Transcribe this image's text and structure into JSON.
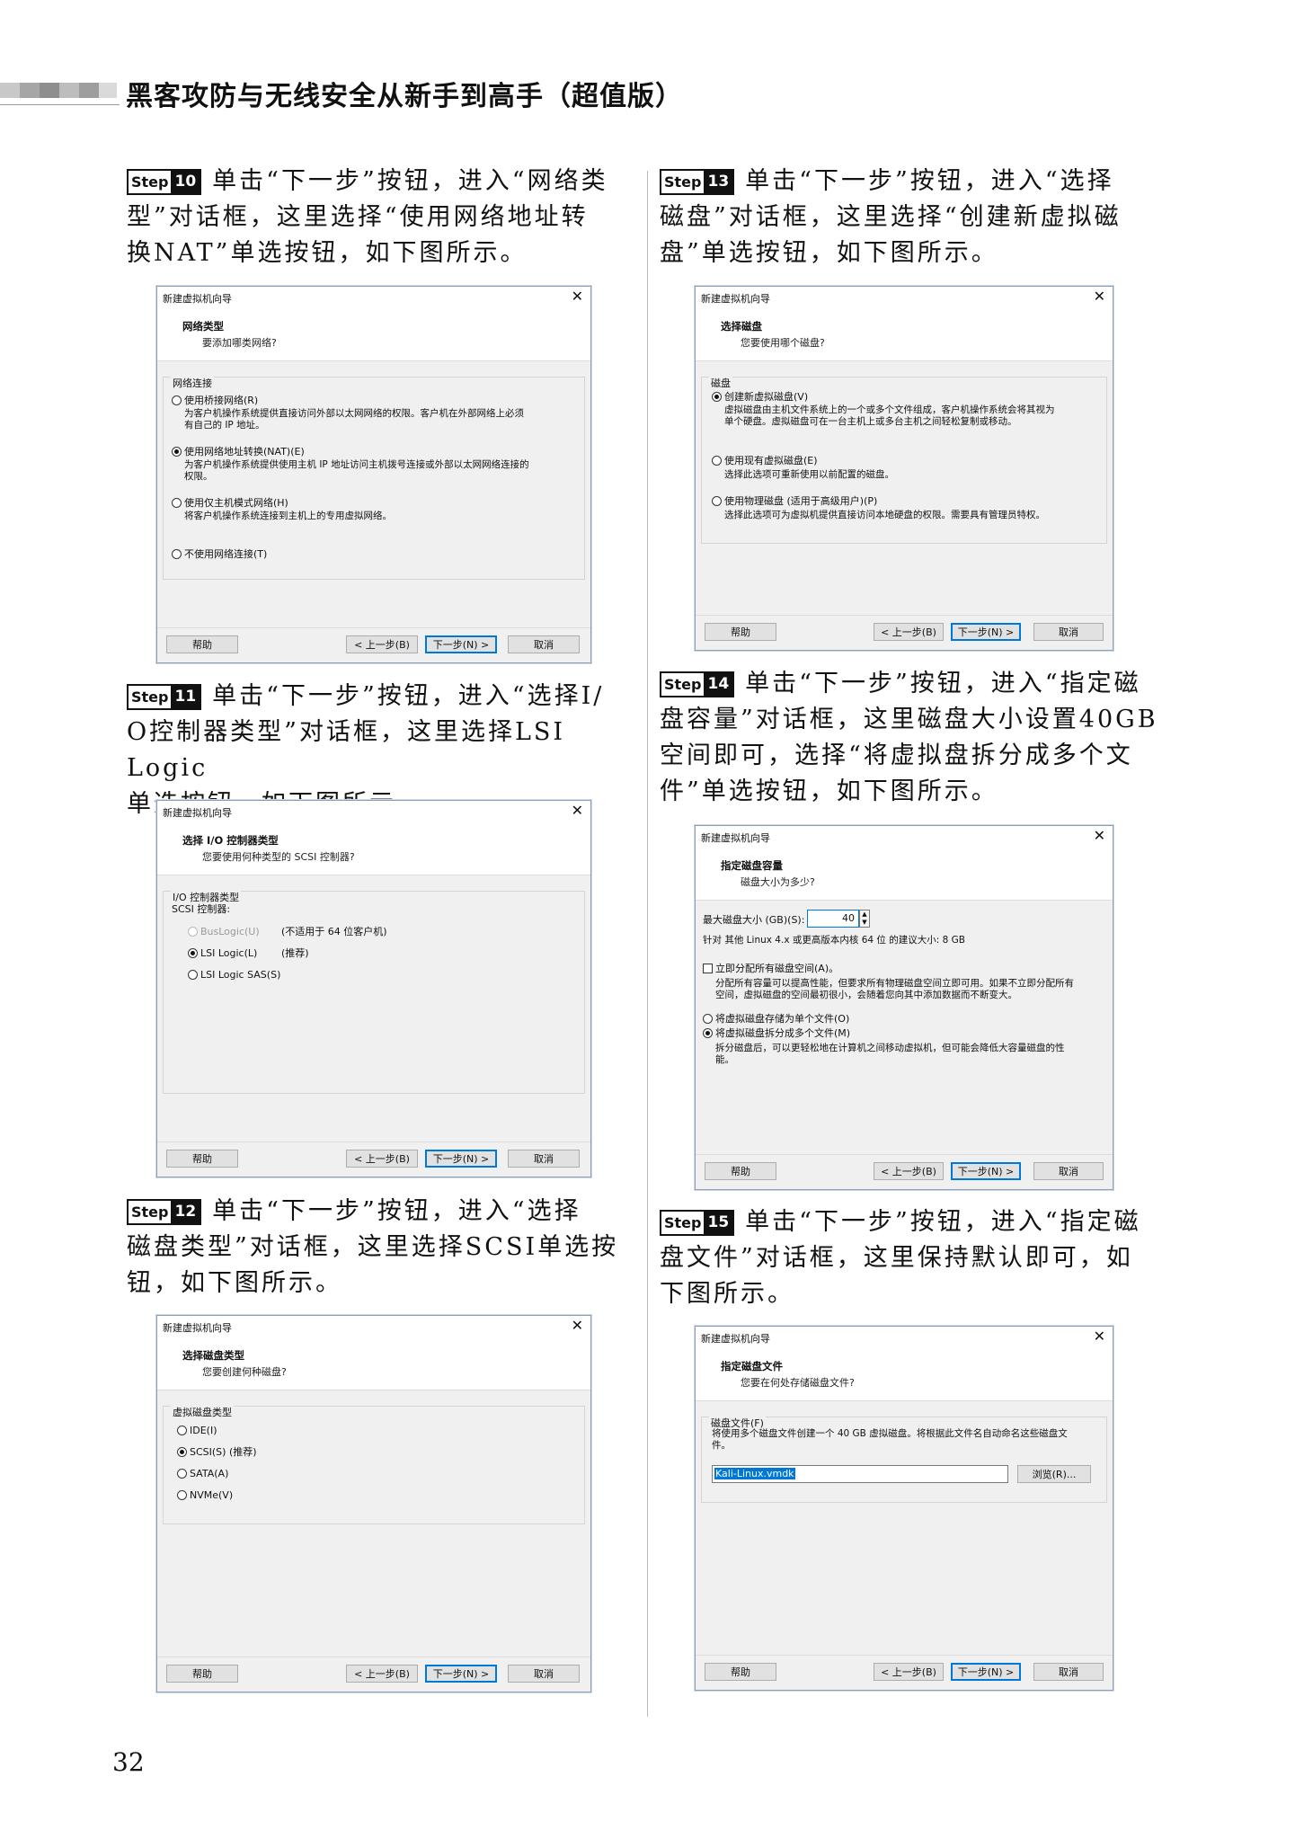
{
  "header": {
    "title": "黑客攻防与无线安全从新手到高手（超值版）",
    "bar_colors": [
      "#d0d0d0",
      "#b0b0b0",
      "#9a9a9a",
      "#c8c8c8",
      "#a8a8a8",
      "#e0e0e0"
    ]
  },
  "page_number": "32",
  "steps": [
    {
      "badge_word": "Step",
      "num": "10",
      "lines": [
        "单击“下一步”按钮，进入“网络类",
        "型”对话框，这里选择“使用网络地址转",
        "换NAT”单选按钮，如下图所示。"
      ]
    },
    {
      "badge_word": "Step",
      "num": "11",
      "lines": [
        "单击“下一步”按钮，进入“选择I/",
        "O控制器类型”对话框，这里选择LSI Logic",
        "单选按钮，如下图所示。"
      ]
    },
    {
      "badge_word": "Step",
      "num": "12",
      "lines": [
        "单击“下一步”按钮，进入“选择",
        "磁盘类型”对话框，这里选择SCSI单选按",
        "钮，如下图所示。"
      ]
    },
    {
      "badge_word": "Step",
      "num": "13",
      "lines": [
        "单击“下一步”按钮，进入“选择",
        "磁盘”对话框，这里选择“创建新虚拟磁",
        "盘”单选按钮，如下图所示。"
      ]
    },
    {
      "badge_word": "Step",
      "num": "14",
      "lines": [
        "单击“下一步”按钮，进入“指定磁",
        "盘容量”对话框，这里磁盘大小设置40GB",
        "空间即可，选择“将虚拟盘拆分成多个文",
        "件”单选按钮，如下图所示。"
      ]
    },
    {
      "badge_word": "Step",
      "num": "15",
      "lines": [
        "单击“下一步”按钮，进入“指定磁",
        "盘文件”对话框，这里保持默认即可，如",
        "下图所示。"
      ]
    }
  ],
  "dialog_common": {
    "window_title": "新建虚拟机向导",
    "close_glyph": "✕",
    "help": "帮助",
    "back": "< 上一步(B)",
    "next": "下一步(N) >",
    "cancel": "取消"
  },
  "dlg10": {
    "heading": "网络类型",
    "subheading": "要添加哪类网络?",
    "group": "网络连接",
    "options": [
      {
        "label": "使用桥接网络(R)",
        "desc": [
          "为客户机操作系统提供直接访问外部以太网网络的权限。客户机在外部网络上必须",
          "有自己的 IP 地址。"
        ],
        "selected": false
      },
      {
        "label": "使用网络地址转换(NAT)(E)",
        "desc": [
          "为客户机操作系统提供使用主机 IP 地址访问主机拨号连接或外部以太网网络连接的",
          "权限。"
        ],
        "selected": true
      },
      {
        "label": "使用仅主机模式网络(H)",
        "desc": [
          "将客户机操作系统连接到主机上的专用虚拟网络。"
        ],
        "selected": false
      },
      {
        "label": "不使用网络连接(T)",
        "desc": [],
        "selected": false
      }
    ]
  },
  "dlg11": {
    "heading": "选择 I/O 控制器类型",
    "subheading": "您要使用何种类型的 SCSI 控制器?",
    "group": "I/O 控制器类型",
    "sub_label": "SCSI 控制器:",
    "options": [
      {
        "label": "BusLogic(U)",
        "note": "(不适用于 64 位客户机)",
        "selected": false,
        "disabled": true
      },
      {
        "label": "LSI Logic(L)",
        "note": "(推荐)",
        "selected": true,
        "disabled": false
      },
      {
        "label": "LSI Logic SAS(S)",
        "note": "",
        "selected": false,
        "disabled": false
      }
    ]
  },
  "dlg12": {
    "heading": "选择磁盘类型",
    "subheading": "您要创建何种磁盘?",
    "group": "虚拟磁盘类型",
    "options": [
      {
        "label": "IDE(I)",
        "selected": false
      },
      {
        "label": "SCSI(S)  (推荐)",
        "selected": true
      },
      {
        "label": "SATA(A)",
        "selected": false
      },
      {
        "label": "NVMe(V)",
        "selected": false
      }
    ]
  },
  "dlg13": {
    "heading": "选择磁盘",
    "subheading": "您要使用哪个磁盘?",
    "group": "磁盘",
    "options": [
      {
        "label": "创建新虚拟磁盘(V)",
        "desc": [
          "虚拟磁盘由主机文件系统上的一个或多个文件组成，客户机操作系统会将其视为",
          "单个硬盘。虚拟磁盘可在一台主机上或多台主机之间轻松复制或移动。"
        ],
        "selected": true
      },
      {
        "label": "使用现有虚拟磁盘(E)",
        "desc": [
          "选择此选项可重新使用以前配置的磁盘。"
        ],
        "selected": false
      },
      {
        "label": "使用物理磁盘 (适用于高级用户)(P)",
        "desc": [
          "选择此选项可为虚拟机提供直接访问本地硬盘的权限。需要具有管理员特权。"
        ],
        "selected": false
      }
    ]
  },
  "dlg14": {
    "heading": "指定磁盘容量",
    "subheading": "磁盘大小为多少?",
    "size_label": "最大磁盘大小 (GB)(S):",
    "size_value": "40",
    "recommend": "针对 其他 Linux 4.x 或更高版本内核 64 位 的建议大小: 8 GB",
    "allocate_label": "立即分配所有磁盘空间(A)。",
    "allocate_checked": false,
    "allocate_desc": [
      "分配所有容量可以提高性能，但要求所有物理磁盘空间立即可用。如果不立即分配所有",
      "空间，虚拟磁盘的空间最初很小，会随着您向其中添加数据而不断变大。"
    ],
    "options": [
      {
        "label": "将虚拟磁盘存储为单个文件(O)",
        "desc": [],
        "selected": false
      },
      {
        "label": "将虚拟磁盘拆分成多个文件(M)",
        "desc": [
          "拆分磁盘后，可以更轻松地在计算机之间移动虚拟机，但可能会降低大容量磁盘的性",
          "能。"
        ],
        "selected": true
      }
    ]
  },
  "dlg15": {
    "heading": "指定磁盘文件",
    "subheading": "您要在何处存储磁盘文件?",
    "group": "磁盘文件(F)",
    "desc": [
      "将使用多个磁盘文件创建一个 40 GB 虚拟磁盘。将根据此文件名自动命名这些磁盘文",
      "件。"
    ],
    "file_value": "Kali-Linux.vmdk",
    "browse": "浏览(R)..."
  }
}
